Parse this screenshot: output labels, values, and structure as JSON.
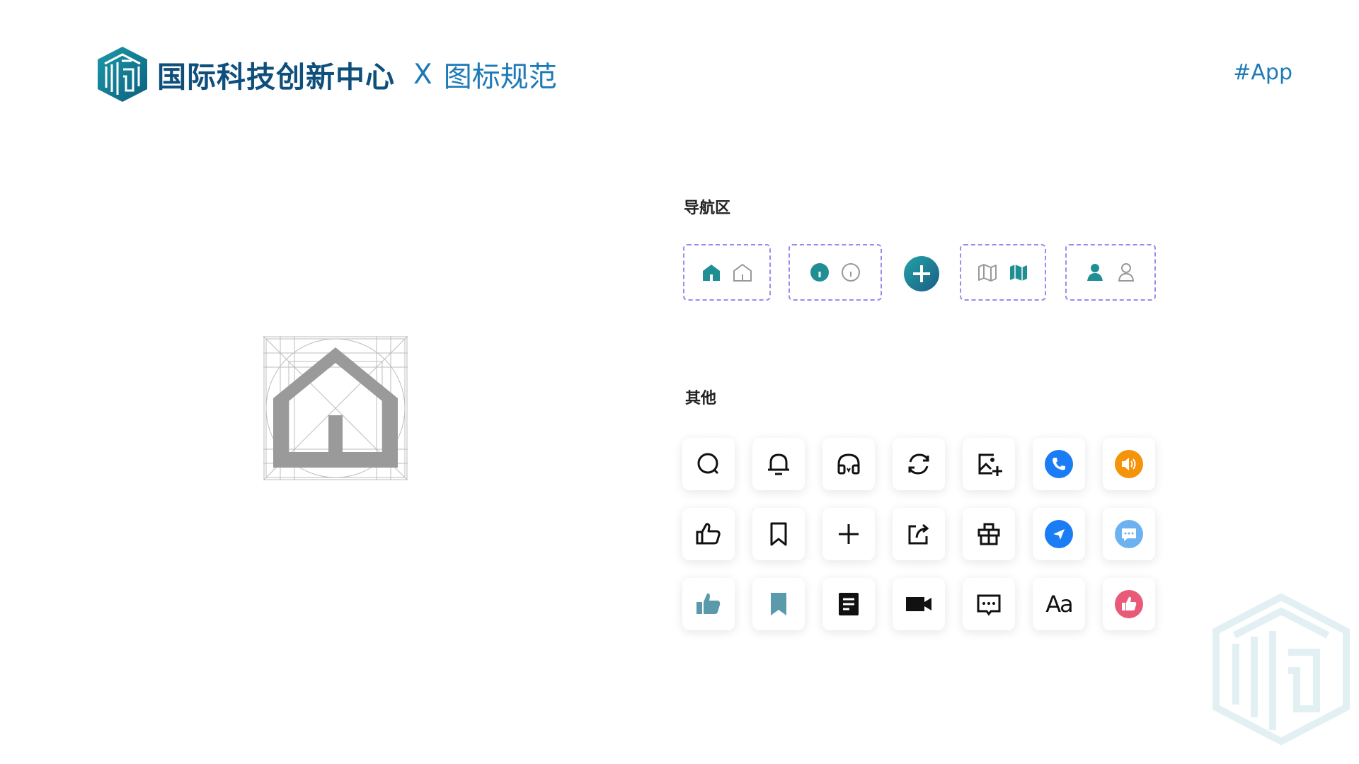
{
  "header": {
    "brand": "国际科技创新中心",
    "separator": "X",
    "spec_title": "图标规范",
    "tag": "#App"
  },
  "sections": {
    "nav_title": "导航区",
    "other_title": "其他"
  },
  "nav_icons": [
    "home-filled-icon",
    "home-outline-icon",
    "info-filled-icon",
    "info-outline-icon",
    "add-circle-icon",
    "map-outline-icon",
    "map-filled-icon",
    "user-filled-icon",
    "user-outline-icon"
  ],
  "other_icons": {
    "row1": [
      "search-icon",
      "bell-icon",
      "headphones-icon",
      "refresh-icon",
      "image-add-icon",
      "phone-icon",
      "volume-icon"
    ],
    "row2": [
      "thumbs-up-outline-icon",
      "bookmark-outline-icon",
      "plus-icon",
      "share-icon",
      "gift-icon",
      "send-icon",
      "chat-icon"
    ],
    "row3": [
      "thumbs-up-filled-icon",
      "bookmark-filled-icon",
      "document-icon",
      "video-camera-icon",
      "comment-box-icon",
      "font-size-icon",
      "like-circle-icon"
    ]
  },
  "font_icon_text": "Aa",
  "colors": {
    "brand_dark": "#0e4f7c",
    "brand_blue": "#1d7ab7",
    "teal": "#1f8f93",
    "dash_border": "#9b8bf0",
    "blue_circle": "#1a7df5",
    "orange_circle": "#f5930a",
    "light_blue_circle": "#6cb2f0",
    "pink_circle": "#e85a78",
    "bookmark_teal": "#5a9aaa"
  }
}
